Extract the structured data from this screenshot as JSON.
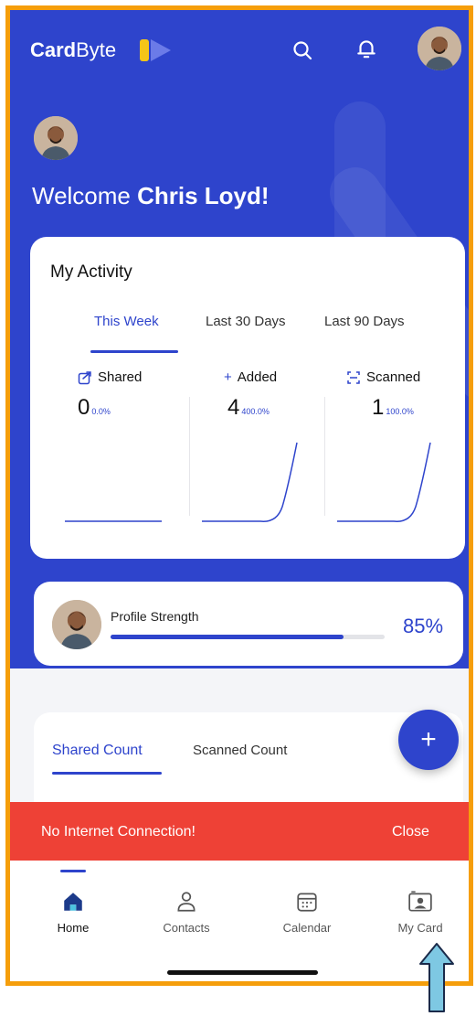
{
  "app": {
    "logo_bold": "Card",
    "logo_light": "Byte"
  },
  "welcome": {
    "prefix": "Welcome ",
    "name": "Chris Loyd!"
  },
  "activity": {
    "title": "My Activity",
    "tabs": [
      "This Week",
      "Last 30 Days",
      "Last 90 Days"
    ],
    "active_tab": "This Week",
    "stats": [
      {
        "label": "Shared",
        "icon": "share-icon",
        "value": "0",
        "pct": "0.0%",
        "trend": "flat"
      },
      {
        "label": "Added",
        "icon": "plus-icon",
        "value": "4",
        "pct": "400.0%",
        "trend": "rising"
      },
      {
        "label": "Scanned",
        "icon": "scan-icon",
        "value": "1",
        "pct": "100.0%",
        "trend": "rising"
      }
    ]
  },
  "profile_strength": {
    "label": "Profile Strength",
    "percent_text": "85%",
    "value": 0.85
  },
  "counts": {
    "tabs": [
      "Shared Count",
      "Scanned Count"
    ],
    "active_tab": "Shared Count"
  },
  "fab": {
    "label": "+"
  },
  "banner": {
    "message": "No Internet Connection!",
    "close_label": "Close",
    "color": "#ee4136"
  },
  "nav": {
    "items": [
      {
        "label": "Home",
        "icon": "home-icon",
        "active": true
      },
      {
        "label": "Contacts",
        "icon": "contacts-icon",
        "active": false
      },
      {
        "label": "Calendar",
        "icon": "calendar-icon",
        "active": false
      },
      {
        "label": "My Card",
        "icon": "card-icon",
        "active": false
      }
    ]
  },
  "colors": {
    "primary": "#2e44cc",
    "frame_highlight": "#f59e0b",
    "arrow_annotation": "#7ec8e3"
  }
}
